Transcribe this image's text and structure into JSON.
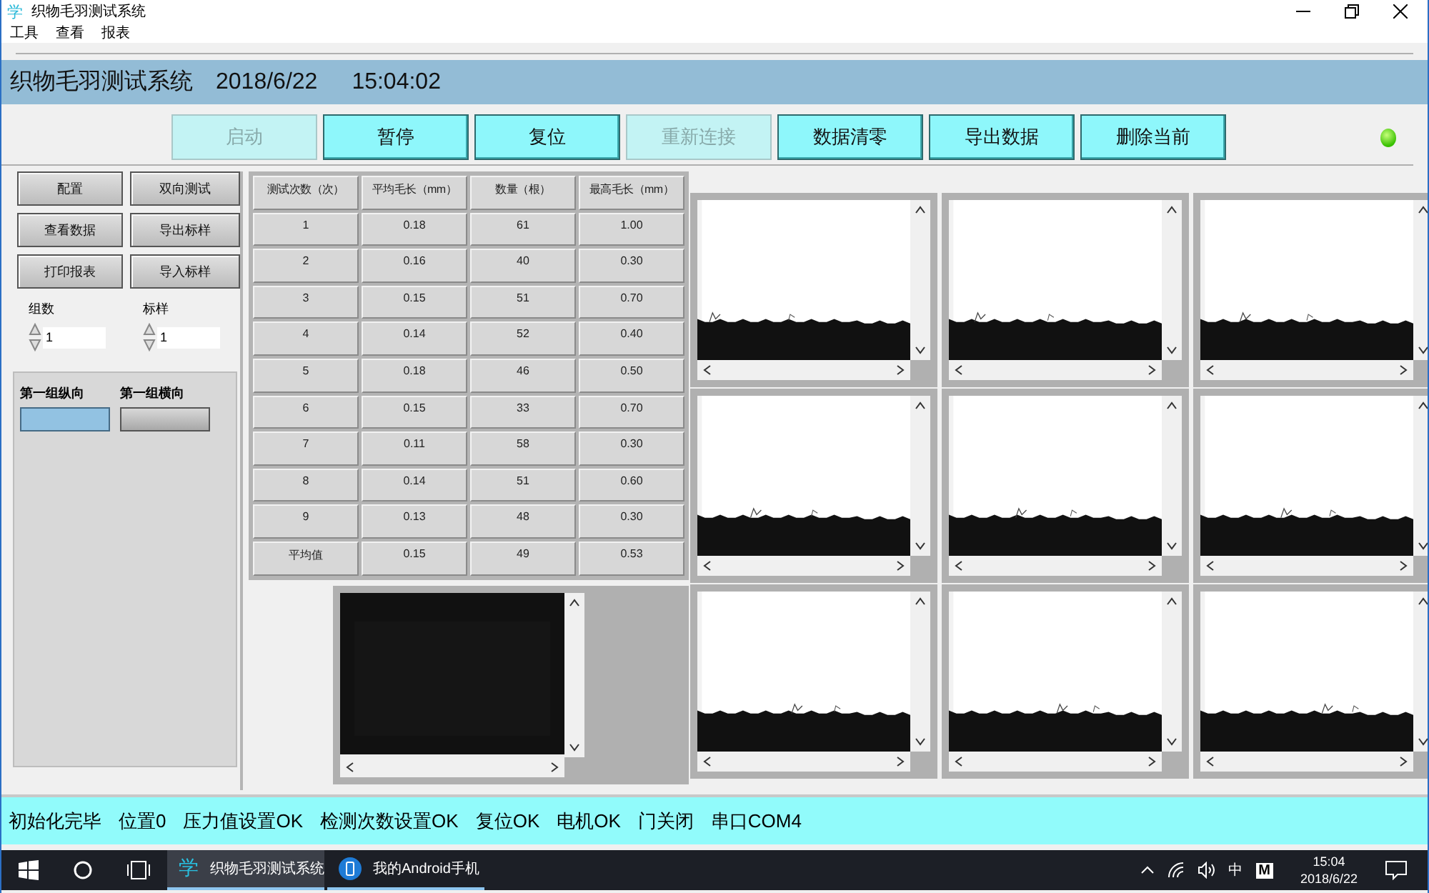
{
  "window": {
    "title": "织物毛羽测试系统",
    "app_icon": "学"
  },
  "menu": [
    "工具",
    "查看",
    "报表"
  ],
  "header": {
    "title": "织物毛羽测试系统",
    "date": "2018/6/22",
    "time": "15:04:02"
  },
  "toolbar": [
    {
      "label": "启动",
      "disabled": true
    },
    {
      "label": "暂停",
      "disabled": false
    },
    {
      "label": "复位",
      "disabled": false
    },
    {
      "label": "重新连接",
      "disabled": true
    },
    {
      "label": "数据清零",
      "disabled": false
    },
    {
      "label": "导出数据",
      "disabled": false
    },
    {
      "label": "删除当前",
      "disabled": false
    }
  ],
  "status_led": {
    "on": true
  },
  "side_buttons": [
    "配置",
    "双向测试",
    "查看数据",
    "导出标样",
    "打印报表",
    "导入标样"
  ],
  "spinners": [
    {
      "label": "组数",
      "value": "1"
    },
    {
      "label": "标样",
      "value": "1"
    }
  ],
  "directions": [
    {
      "label": "第一组纵向",
      "selected": true
    },
    {
      "label": "第一组横向",
      "selected": false
    }
  ],
  "table": {
    "columns": [
      "测试次数（次）",
      "平均毛长（mm）",
      "数量（根）",
      "最高毛长（mm）"
    ],
    "rows": [
      [
        "1",
        "0.18",
        "61",
        "1.00"
      ],
      [
        "2",
        "0.16",
        "40",
        "0.30"
      ],
      [
        "3",
        "0.15",
        "51",
        "0.70"
      ],
      [
        "4",
        "0.14",
        "52",
        "0.40"
      ],
      [
        "5",
        "0.18",
        "46",
        "0.50"
      ],
      [
        "6",
        "0.15",
        "33",
        "0.70"
      ],
      [
        "7",
        "0.11",
        "58",
        "0.30"
      ],
      [
        "8",
        "0.14",
        "51",
        "0.60"
      ],
      [
        "9",
        "0.13",
        "48",
        "0.30"
      ],
      [
        "平均值",
        "0.15",
        "49",
        "0.53"
      ]
    ]
  },
  "preview": {
    "kind": "picture"
  },
  "images": [
    {
      "kind": "picture"
    },
    {
      "kind": "picture"
    },
    {
      "kind": "picture"
    },
    {
      "kind": "picture"
    },
    {
      "kind": "picture"
    },
    {
      "kind": "picture"
    },
    {
      "kind": "picture"
    },
    {
      "kind": "picture"
    },
    {
      "kind": "picture"
    }
  ],
  "status_bar": [
    "初始化完毕",
    "位置0",
    "压力值设置OK",
    "检测次数设置OK",
    "复位OK",
    "电机OK",
    "门关闭",
    "串口COM4"
  ],
  "taskbar": {
    "apps": [
      {
        "label": "织物毛羽测试系统",
        "icon": "学",
        "selected": true
      },
      {
        "label": "我的Android手机",
        "selected": false
      }
    ],
    "ime": "中",
    "ime_mode": "M",
    "time": "15:04",
    "date": "2018/6/22"
  }
}
